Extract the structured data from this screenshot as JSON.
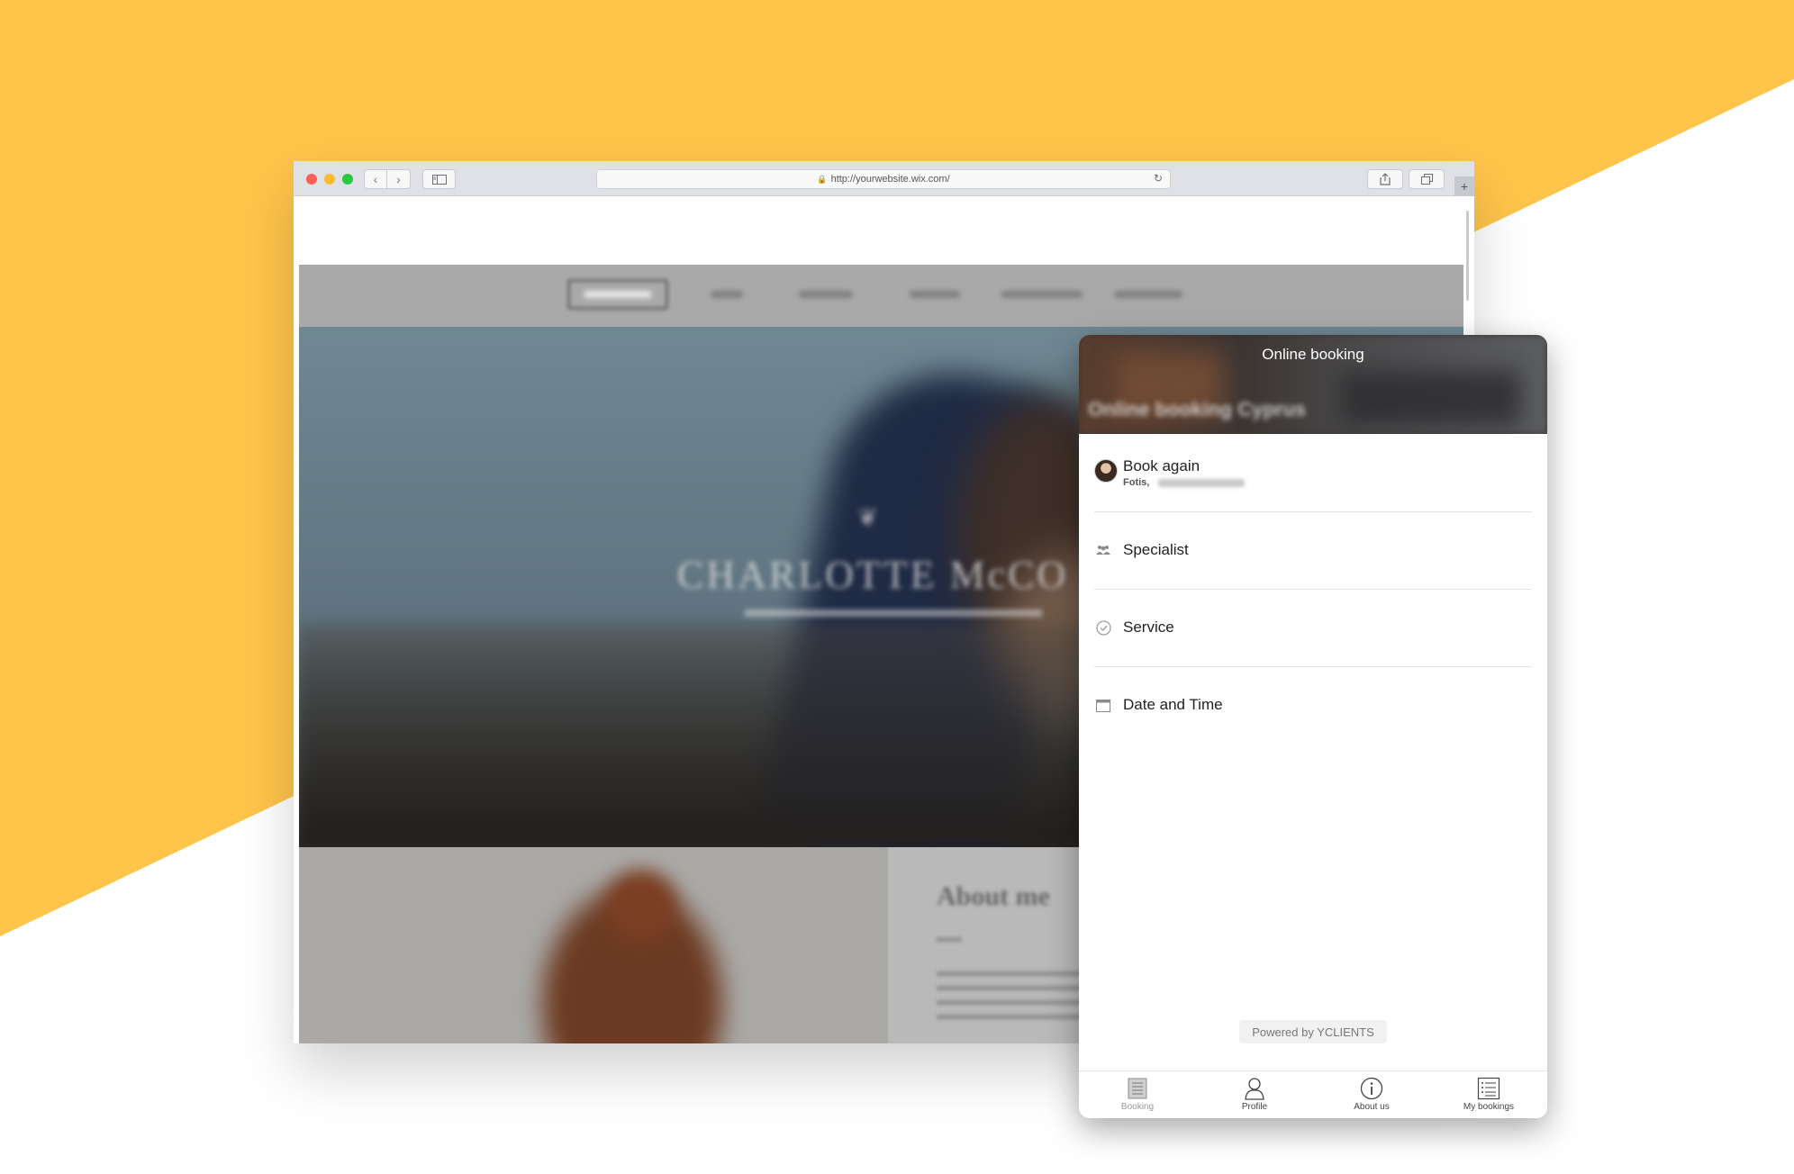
{
  "background": {
    "yellow": "#FFC54A",
    "white": "#FFFFFF"
  },
  "browser": {
    "url": "http://yourwebsite.wix.com/",
    "controls": {
      "back": "‹",
      "forward": "›",
      "new_tab": "+"
    }
  },
  "website": {
    "hero_title": "CHARLOTTE McCO",
    "about_title": "About me"
  },
  "widget": {
    "title": "Online booking",
    "subtitle": "Online booking Cyprus",
    "items": [
      {
        "label": "Book again",
        "detail": "Fotis,",
        "icon": "avatar"
      },
      {
        "label": "Specialist",
        "icon": "people-icon"
      },
      {
        "label": "Service",
        "icon": "check-circle-icon"
      },
      {
        "label": "Date and Time",
        "icon": "calendar-icon"
      }
    ],
    "powered_by": "Powered by YCLIENTS",
    "tabs": [
      {
        "label": "Booking",
        "icon": "booking-icon",
        "active": true
      },
      {
        "label": "Profile",
        "icon": "profile-icon",
        "active": false
      },
      {
        "label": "About us",
        "icon": "info-icon",
        "active": false
      },
      {
        "label": "My bookings",
        "icon": "list-icon",
        "active": false
      }
    ]
  }
}
